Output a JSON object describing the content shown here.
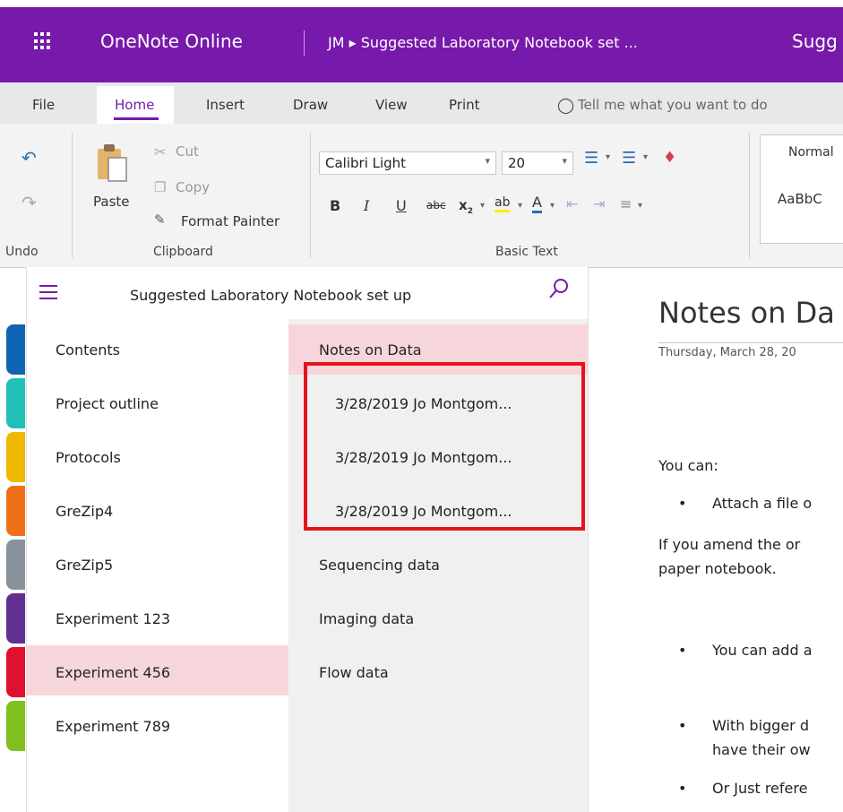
{
  "app": {
    "name": "OneNote Online",
    "breadcrumb": "JM ▸ Suggested Laboratory Notebook set ...",
    "title_right": "Sugg"
  },
  "ribbon": {
    "tabs": [
      "File",
      "Home",
      "Insert",
      "Draw",
      "View",
      "Print"
    ],
    "active_tab": "Home",
    "tell_me": "Tell me what you want to do",
    "undo_label": "Undo",
    "paste_label": "Paste",
    "cut_label": "Cut",
    "copy_label": "Copy",
    "format_painter_label": "Format Painter",
    "clipboard_label": "Clipboard",
    "font_name": "Calibri Light",
    "font_size": "20",
    "basic_text_label": "Basic Text",
    "styles": {
      "normal": "Normal",
      "sample": "AaBbC"
    }
  },
  "notebook": {
    "title": "Suggested Laboratory Notebook set up"
  },
  "sections": [
    {
      "label": "Contents",
      "color": "#1064b4"
    },
    {
      "label": "Project outline",
      "color": "#20c0b8"
    },
    {
      "label": "Protocols",
      "color": "#f0b800"
    },
    {
      "label": "GreZip4",
      "color": "#f07018"
    },
    {
      "label": "GreZip5",
      "color": "#88929c"
    },
    {
      "label": "Experiment 123",
      "color": "#603090"
    },
    {
      "label": "Experiment 456",
      "color": "#e01030"
    },
    {
      "label": "Experiment 789",
      "color": "#80c020"
    }
  ],
  "selected_section": "Experiment 456",
  "pages": [
    {
      "label": "Notes on Data",
      "indent": false
    },
    {
      "label": "3/28/2019 Jo Montgom...",
      "indent": true
    },
    {
      "label": "3/28/2019 Jo Montgom...",
      "indent": true
    },
    {
      "label": "3/28/2019 Jo Montgom...",
      "indent": true
    },
    {
      "label": "Sequencing data",
      "indent": false
    },
    {
      "label": "Imaging data",
      "indent": false
    },
    {
      "label": "Flow data",
      "indent": false
    }
  ],
  "selected_page": "Notes on Data",
  "content": {
    "title": "Notes on Da",
    "date": "Thursday, March 28, 20",
    "lines": {
      "you_can": "You can:",
      "b1": "Attach a file o",
      "p1": "If you amend the or",
      "p2": "paper notebook.",
      "b2": "You can add a",
      "b3a": "With bigger d",
      "b3b": "have their ow",
      "b4": "Or Just refere"
    }
  },
  "colors": {
    "brand": "#7719aa",
    "selection": "#f6d6db",
    "highlight_box": "#e4141c"
  }
}
